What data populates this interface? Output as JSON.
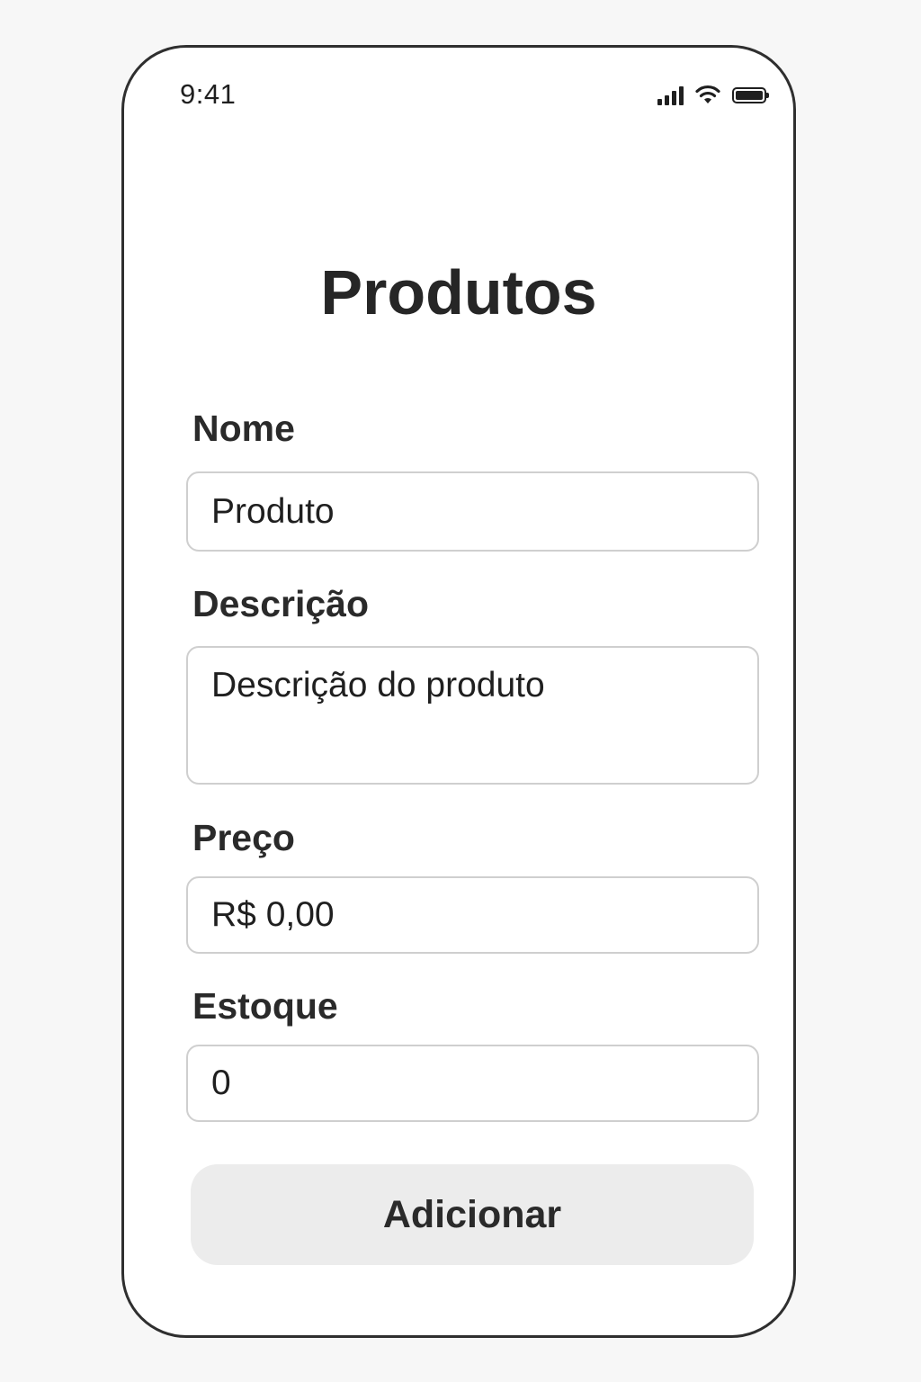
{
  "status_bar": {
    "time": "9:41",
    "icons": [
      "cellular-signal-icon",
      "wifi-icon",
      "battery-icon"
    ]
  },
  "page": {
    "title": "Produtos"
  },
  "form": {
    "nome": {
      "label": "Nome",
      "value": "Produto"
    },
    "descricao": {
      "label": "Descrição",
      "value": "Descrição do produto"
    },
    "preco": {
      "label": "Preço",
      "value": "R$ 0,00"
    },
    "estoque": {
      "label": "Estoque",
      "value": "0"
    }
  },
  "actions": {
    "submit_label": "Adicionar"
  },
  "colors": {
    "background": "#f7f7f7",
    "phone_border": "#2f2f2f",
    "text": "#262626",
    "input_border": "#cfcfcf",
    "button_bg": "#ececec"
  }
}
